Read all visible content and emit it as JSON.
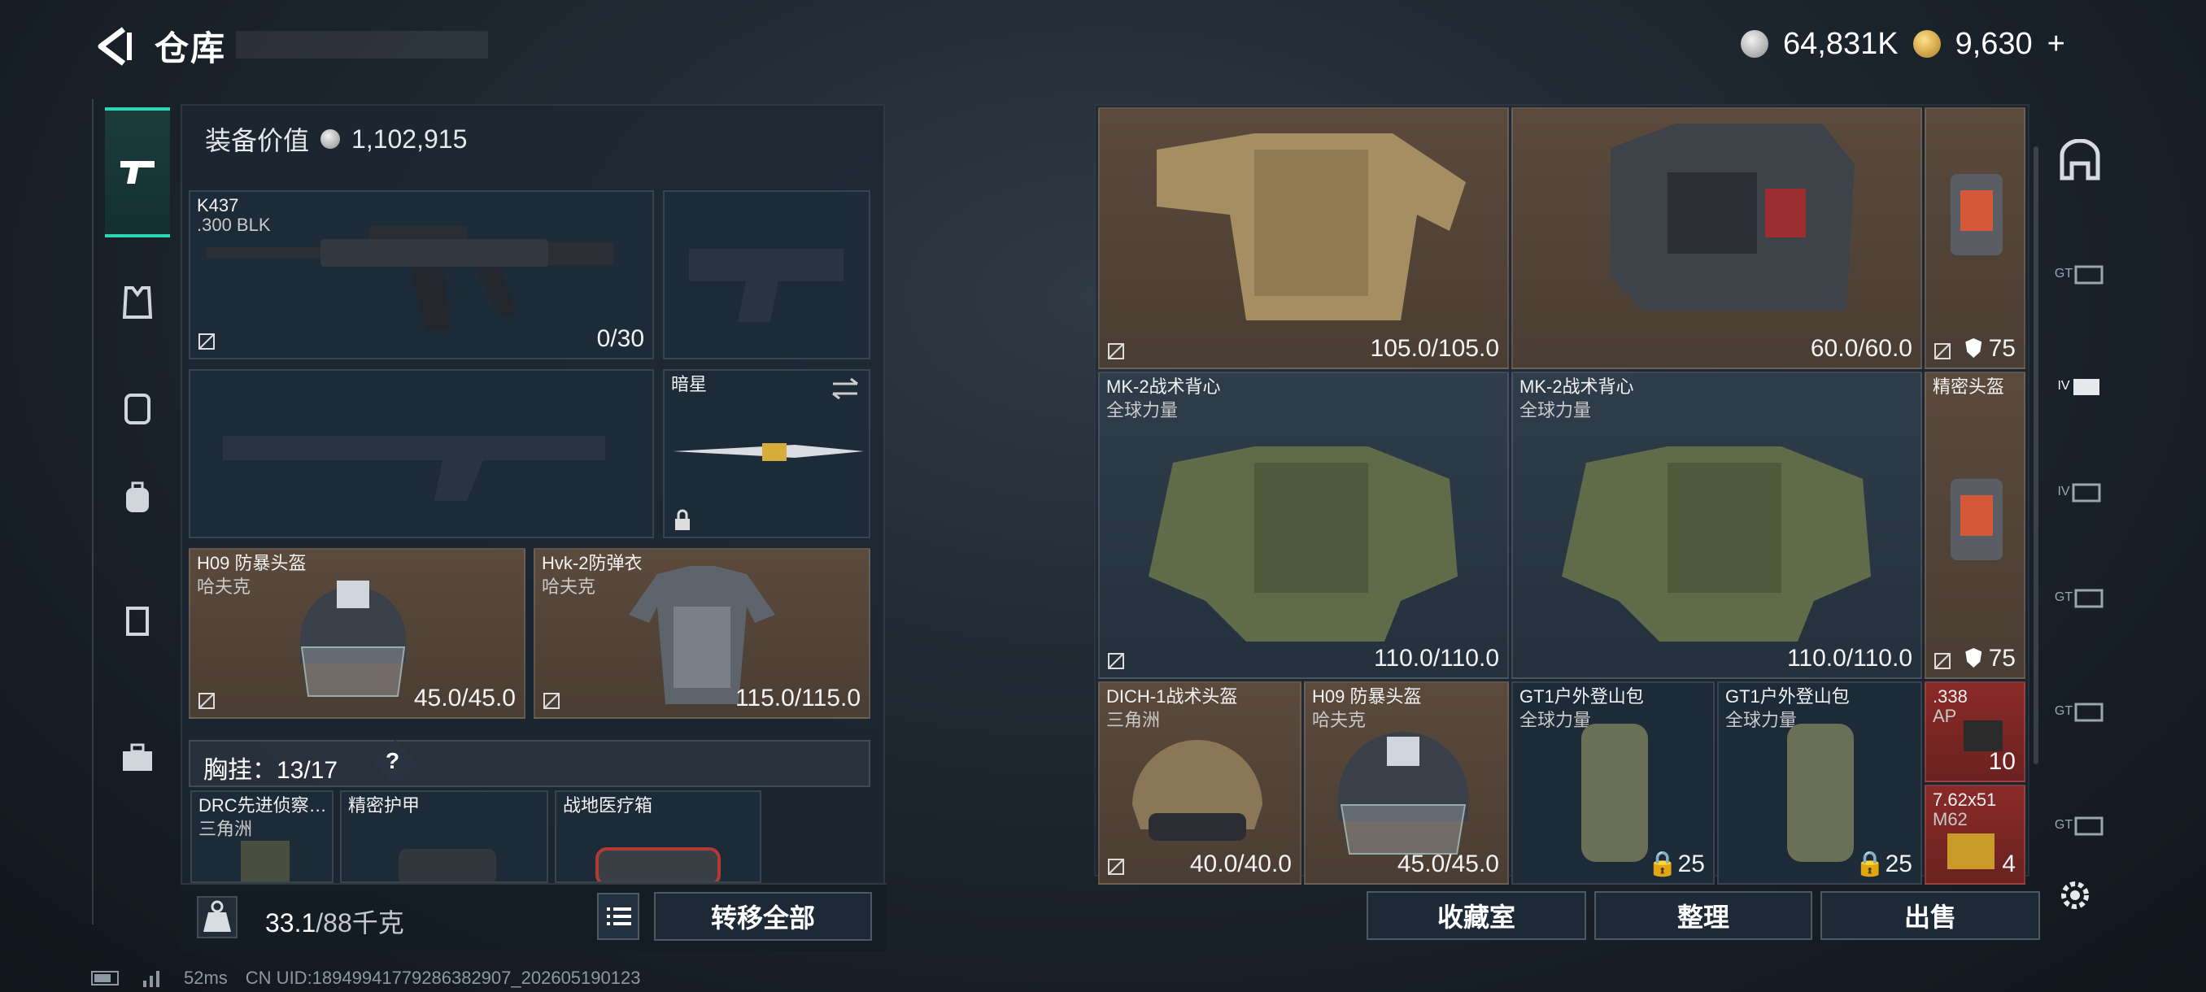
{
  "header": {
    "title": "仓库",
    "currency_a": "64,831K",
    "currency_b": "9,630",
    "currency_add": "+"
  },
  "left_rail": {
    "items": [
      "pistol-icon",
      "vest-icon",
      "backpack-icon",
      "bag-icon",
      "box-icon",
      "toolbox-icon"
    ]
  },
  "loadout": {
    "value_label": "装备价值",
    "value": "1,102,915",
    "primary": {
      "name": "K437",
      "caliber": ".300 BLK",
      "ammo": "0/30"
    },
    "melee": {
      "name": "暗星"
    },
    "helmet": {
      "name": "H09 防暴头盔",
      "brand": "哈夫克",
      "durability": "45.0/45.0"
    },
    "armor": {
      "name": "Hvk-2防弹衣",
      "brand": "哈夫克",
      "durability": "115.0/115.0"
    },
    "chest": {
      "label": "胸挂：13/17",
      "help": "?"
    },
    "chest_items": [
      {
        "name": "DRC先进侦察…",
        "brand": "三角洲"
      },
      {
        "name": "精密护甲",
        "brand": ""
      },
      {
        "name": "战地医疗箱",
        "brand": ""
      }
    ],
    "weight": "33.1",
    "weight_max": "/88千克",
    "transfer_all": "转移全部"
  },
  "storage": {
    "items": [
      {
        "name": "",
        "brand": "",
        "value": "105.0/105.0"
      },
      {
        "name": "",
        "brand": "",
        "value": "60.0/60.0"
      },
      {
        "name": "",
        "brand": "",
        "value": "75"
      },
      {
        "name": "MK-2战术背心",
        "brand": "全球力量",
        "value": "110.0/110.0"
      },
      {
        "name": "MK-2战术背心",
        "brand": "全球力量",
        "value": "110.0/110.0"
      },
      {
        "name": "精密头盔",
        "brand": "",
        "value": "75"
      },
      {
        "name": "DICH-1战术头盔",
        "brand": "三角洲",
        "value": "40.0/40.0"
      },
      {
        "name": "H09 防暴头盔",
        "brand": "哈夫克",
        "value": "45.0/45.0"
      },
      {
        "name": "GT1户外登山包",
        "brand": "全球力量",
        "value": "25"
      },
      {
        "name": "GT1户外登山包",
        "brand": "全球力量",
        "value": "25"
      },
      {
        "name": ".338",
        "brand": "AP",
        "value": "10"
      },
      {
        "name": "7.62x51",
        "brand": "M62",
        "value": "4"
      }
    ],
    "buttons": {
      "collection": "收藏室",
      "sort": "整理",
      "sell": "出售"
    }
  },
  "right_rail": {
    "labels": [
      "",
      "GT",
      "IV",
      "IV",
      "GT",
      "GT",
      "GT"
    ]
  },
  "status": {
    "ping": "52ms",
    "uid": "CN UID:18949941779286382907_202605190123"
  }
}
